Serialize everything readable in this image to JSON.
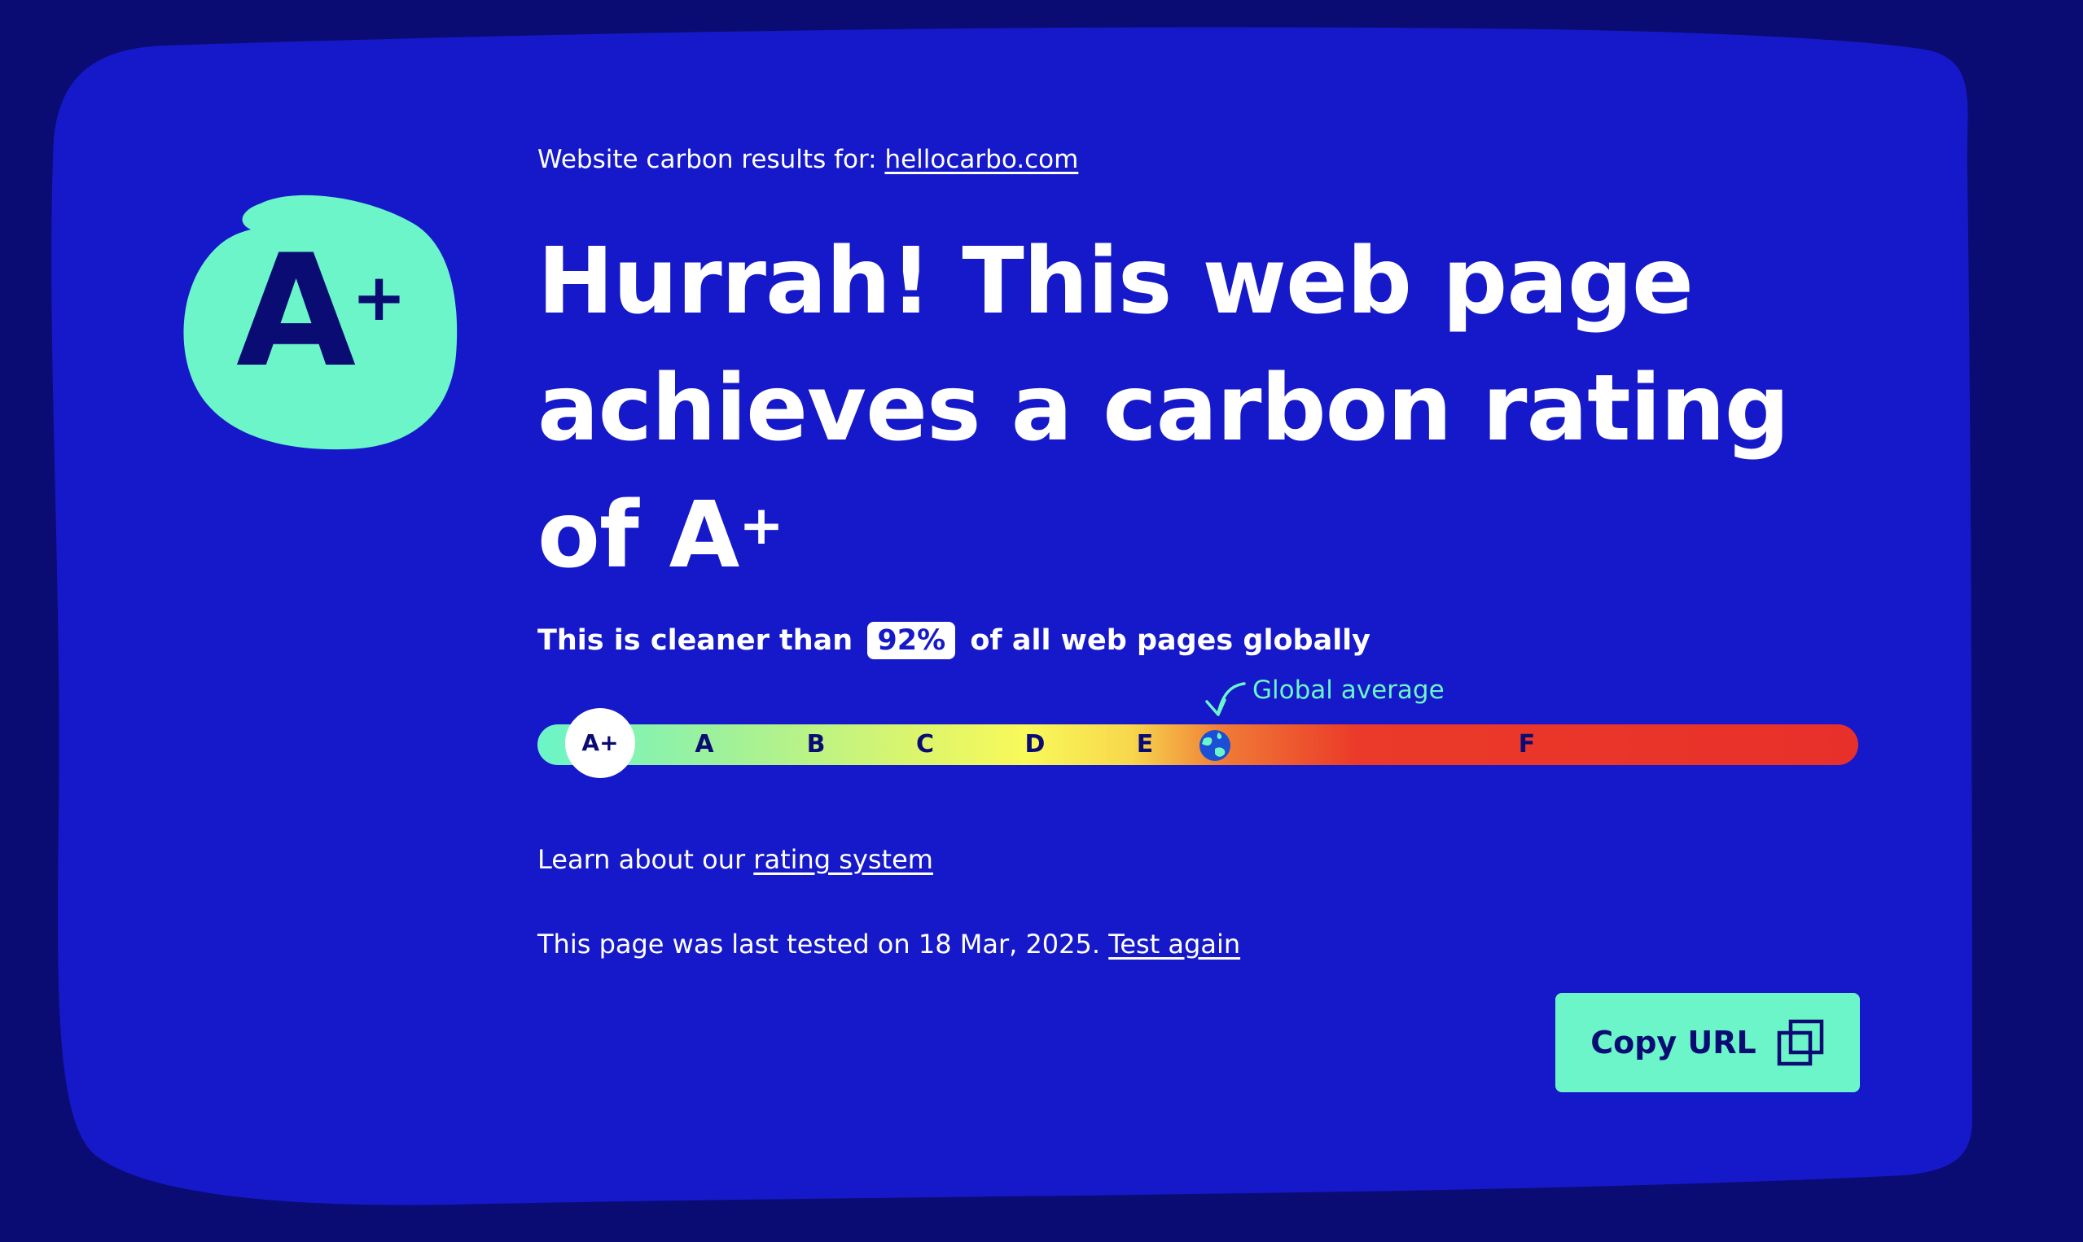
{
  "header": {
    "results_prefix": "Website carbon results for: ",
    "site_link": "hellocarbo.com"
  },
  "badge": {
    "grade_letter": "A",
    "grade_modifier": "+",
    "color": "#6bf5c8"
  },
  "headline": {
    "text": "Hurrah! This web page achieves a carbon rating of ",
    "grade_letter": "A",
    "grade_modifier": "+"
  },
  "comparison": {
    "prefix": "This is cleaner than",
    "percentage": "92%",
    "suffix": "of all web pages globally",
    "percentage_value": 92
  },
  "scale": {
    "current_grade": "A+",
    "grades": [
      "A",
      "B",
      "C",
      "D",
      "E",
      "F"
    ],
    "global_average_label": "Global average",
    "globe_icon": "globe-icon"
  },
  "learn": {
    "prefix": "Learn about our ",
    "link": "rating system"
  },
  "tested": {
    "prefix": "This page was last tested on 18 Mar, 2025. ",
    "link": "Test again"
  },
  "copy_button": {
    "label": "Copy URL",
    "icon": "copy-icon"
  },
  "colors": {
    "page_background": "#0a0c74",
    "card_background": "#1619c9",
    "accent": "#6bf5c8",
    "text": "#ffffff"
  }
}
